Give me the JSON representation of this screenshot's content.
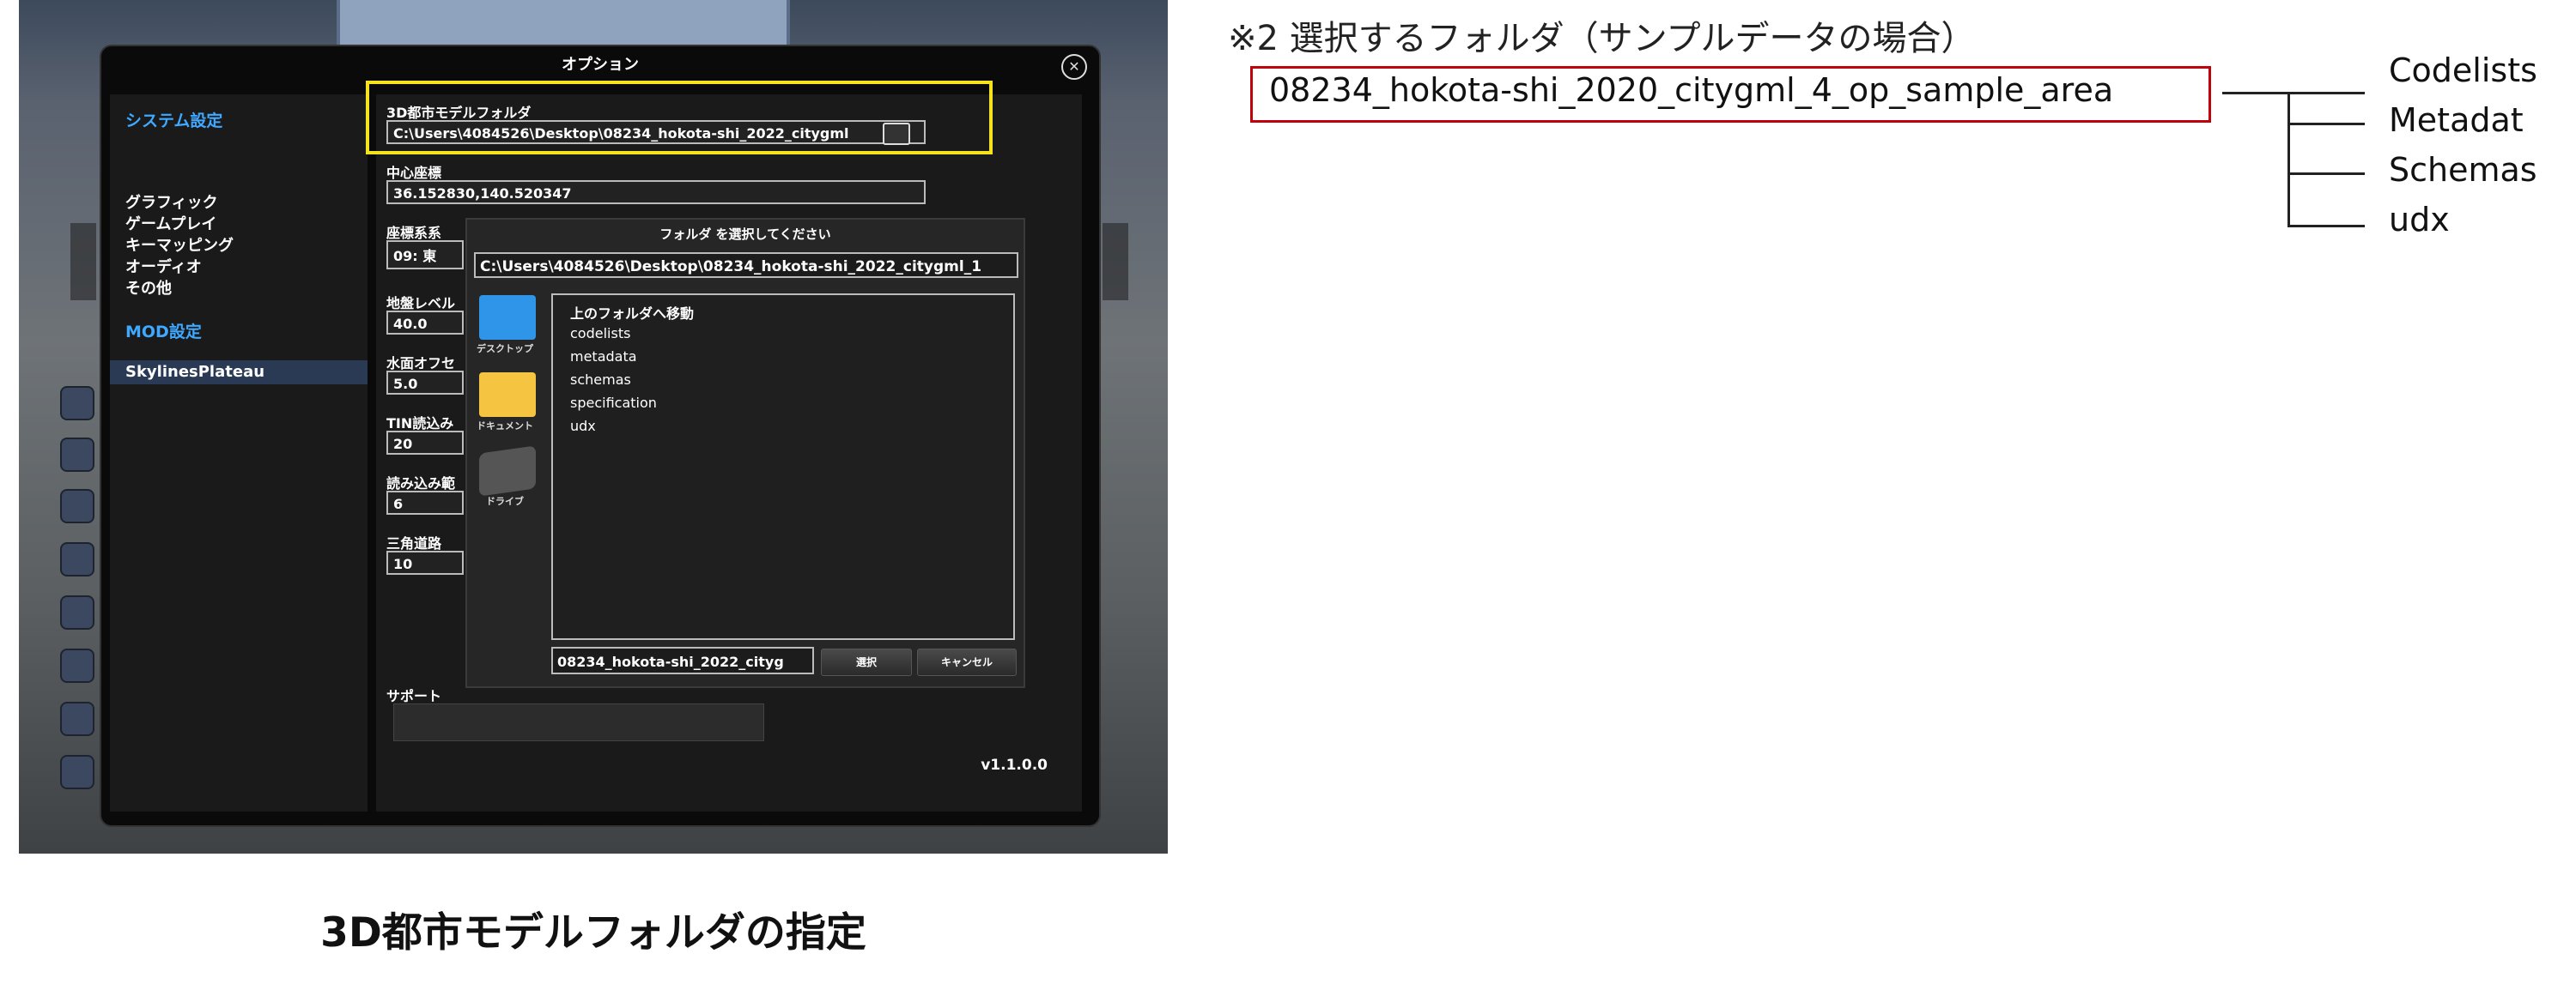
{
  "options_dialog": {
    "title": "オプション",
    "system_section": "システム設定",
    "system_items": [
      "グラフィック",
      "ゲームプレイ",
      "キーマッピング",
      "オーディオ",
      "その他"
    ],
    "mod_section": "MOD設定",
    "mod_items": [
      "SkylinesPlateau"
    ],
    "fields": {
      "model_folder_label": "3D都市モデルフォルダ",
      "model_folder_value": "C:\\Users\\4084526\\Desktop\\08234_hokota-shi_2022_citygml",
      "center_label": "中心座標",
      "center_value": "36.152830,140.520347",
      "coord_label": "座標系系",
      "coord_value": "09: 東",
      "ground_label": "地盤レベル",
      "ground_value": "40.0",
      "water_label": "水面オフセ",
      "water_value": "5.0",
      "tin_label": "TIN読込み",
      "tin_value": "20",
      "load_label": "読み込み範",
      "load_value": "6",
      "road_label": "三角道路",
      "road_value": "10"
    },
    "support_label": "サポート",
    "version": "v1.1.0.0"
  },
  "folder_picker": {
    "title": "フォルダ を選択してください",
    "path": "C:\\Users\\4084526\\Desktop\\08234_hokota-shi_2022_citygml_1",
    "sidebar": [
      "デスクトップ",
      "ドキュメント",
      "ドライブ"
    ],
    "entries": [
      "上のフォルダへ移動",
      "codelists",
      "metadata",
      "schemas",
      "specification",
      "udx"
    ],
    "name_value": "08234_hokota-shi_2022_cityg",
    "select_button": "選択",
    "cancel_button": "キャンセル"
  },
  "caption": "3D都市モデルフォルダの指定",
  "diagram": {
    "note": "※2  選択するフォルダ（サンプルデータの場合）",
    "root": "08234_hokota-shi_2020_citygml_4_op_sample_area",
    "children": [
      "Codelists",
      "Metadat",
      "Schemas",
      "udx"
    ]
  }
}
